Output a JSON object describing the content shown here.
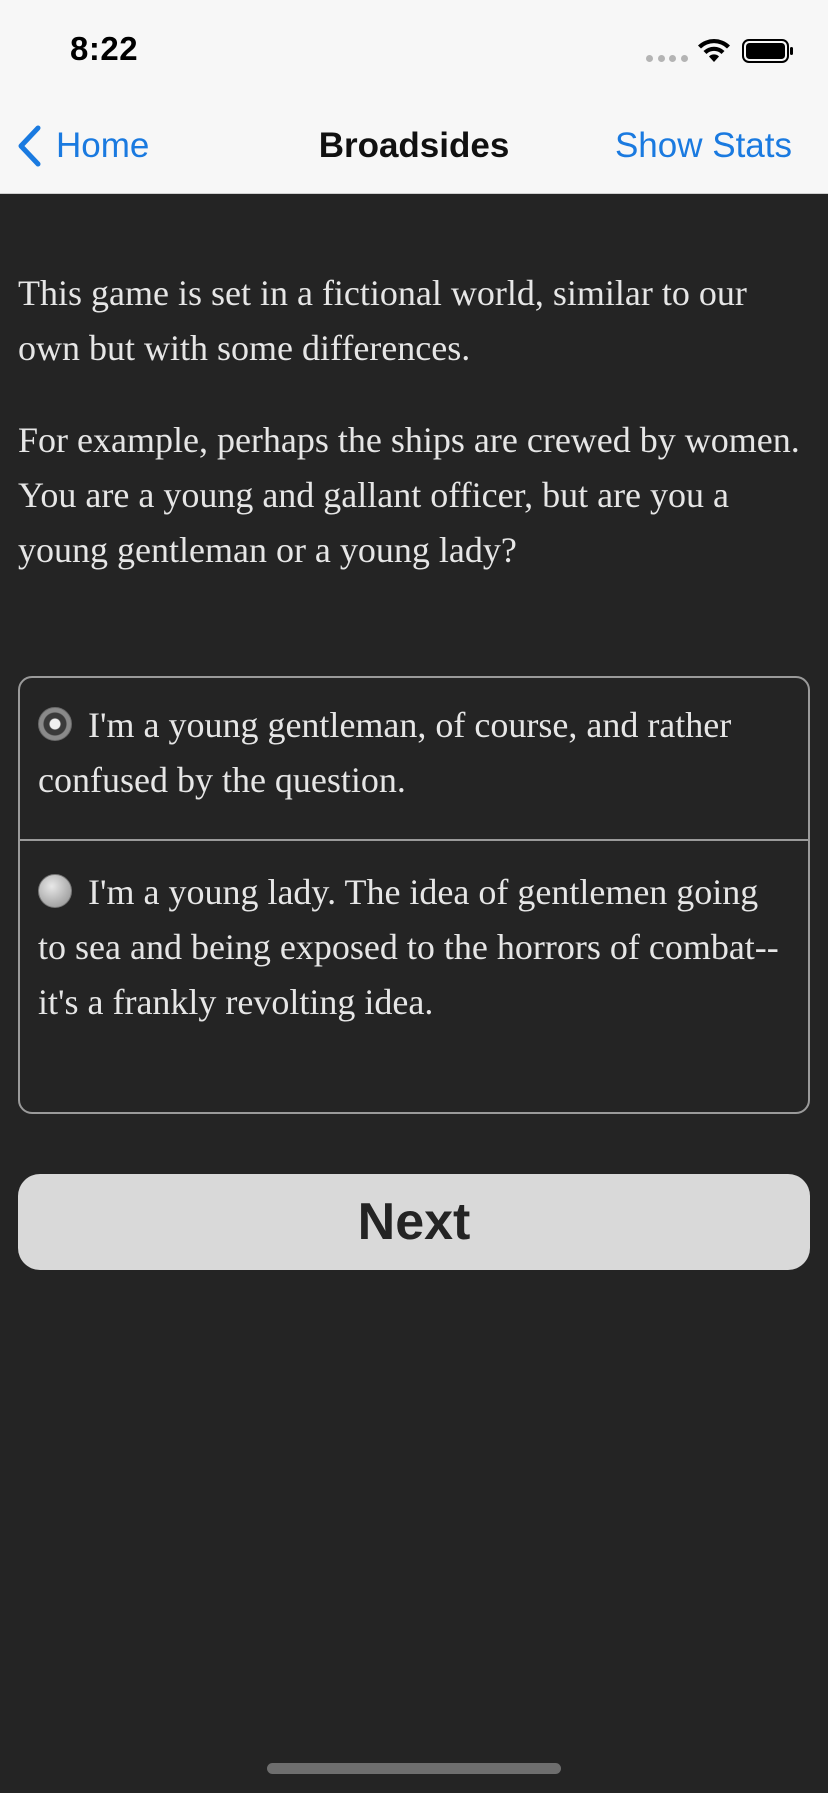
{
  "status_bar": {
    "time": "8:22",
    "signal_icon": "signal-dots-icon",
    "wifi_icon": "wifi-icon",
    "battery_icon": "battery-icon"
  },
  "nav_bar": {
    "back_icon": "chevron-left-icon",
    "back_label": "Home",
    "title": "Broadsides",
    "right_button": "Show Stats"
  },
  "story": {
    "paragraphs": [
      "This game is set in a fictional world, similar to our own but with some differences.",
      "For example, perhaps the ships are crewed by women. You are a young and gallant officer, but are you a young gentleman or a young lady?"
    ]
  },
  "choices": [
    {
      "label": "I'm a young gentleman, of course, and rather confused by the question.",
      "selected": true
    },
    {
      "label": "I'm a young lady. The idea of gentlemen going to sea and being exposed to the horrors of combat--it's a frankly revolting idea.",
      "selected": false
    }
  ],
  "next_button": {
    "label": "Next"
  },
  "colors": {
    "background": "#242424",
    "nav_background": "#f7f7f7",
    "accent": "#1a7ae0",
    "text": "#e6e6e6",
    "button": "#d9d9d9"
  }
}
